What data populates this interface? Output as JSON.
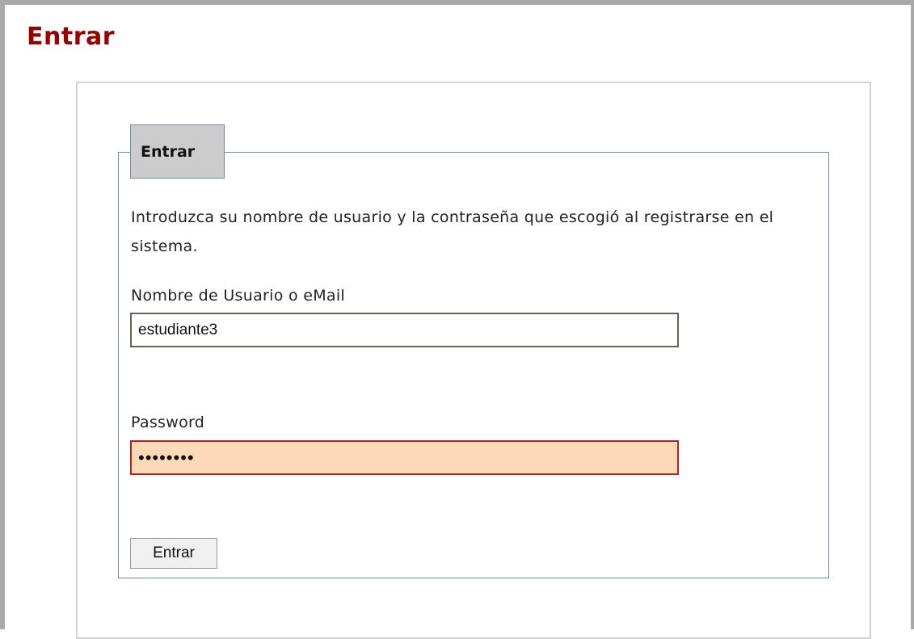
{
  "page": {
    "title": "Entrar"
  },
  "login_form": {
    "legend": "Entrar",
    "intro": "Introduzca su nombre de usuario y la contraseña que escogió al registrarse en el sistema.",
    "username": {
      "label": "Nombre de Usuario o eMail",
      "value": "estudiante3"
    },
    "password": {
      "label": "Password",
      "value": "passwor9"
    },
    "submit_label": "Entrar"
  },
  "colors": {
    "title": "#990000",
    "password_field_bg": "#fdd9b8",
    "password_field_border": "#b22222",
    "legend_bg": "#cccccc",
    "frame_border": "#a9a9a9"
  }
}
